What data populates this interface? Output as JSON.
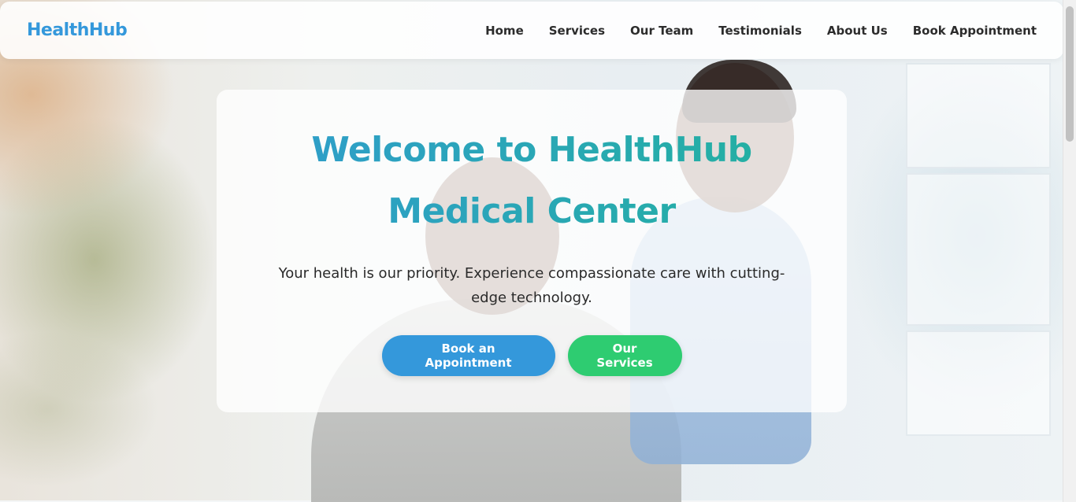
{
  "brand": {
    "name": "HealthHub",
    "color": "#3498db"
  },
  "nav": {
    "items": [
      {
        "label": "Home"
      },
      {
        "label": "Services"
      },
      {
        "label": "Our Team"
      },
      {
        "label": "Testimonials"
      },
      {
        "label": "About Us"
      },
      {
        "label": "Book Appointment"
      }
    ]
  },
  "hero": {
    "title": "Welcome to HealthHub Medical Center",
    "subtitle": "Your health is our priority. Experience compassionate care with cutting-edge technology.",
    "primary_button": "Book an Appointment",
    "secondary_button": "Our Services",
    "colors": {
      "title_gradient_start": "#2f9ec9",
      "title_gradient_end": "#24b0a2",
      "primary_button": "#3498db",
      "secondary_button": "#2ecc71"
    },
    "background_image": "smiling nurse caring for elderly patient"
  }
}
